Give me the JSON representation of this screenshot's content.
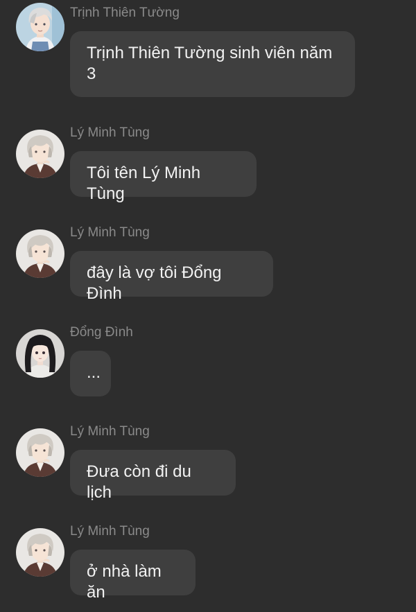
{
  "messages": [
    {
      "sender": "Trịnh Thiên Tường",
      "text": "Trịnh Thiên Tường sinh viên năm 3",
      "avatar": "light-haired-boy-avatar"
    },
    {
      "sender": "Lý Minh Tùng",
      "text": "Tôi tên Lý Minh Tùng",
      "avatar": "silver-haired-man-avatar"
    },
    {
      "sender": "Lý Minh Tùng",
      "text": "đây là vợ tôi Đổng Đình",
      "avatar": "silver-haired-man-avatar"
    },
    {
      "sender": "Đổng Đình",
      "text": "...",
      "avatar": "dark-haired-girl-avatar"
    },
    {
      "sender": "Lý Minh Tùng",
      "text": "Đưa còn đi du lịch",
      "avatar": "silver-haired-man-avatar"
    },
    {
      "sender": "Lý Minh Tùng",
      "text": "ở nhà làm ăn",
      "avatar": "silver-haired-man-avatar"
    }
  ],
  "colors": {
    "background": "#2d2d2d",
    "bubble": "#3f3f3f",
    "sender_name": "#8a8a8a",
    "message_text": "#f2f2f2"
  }
}
